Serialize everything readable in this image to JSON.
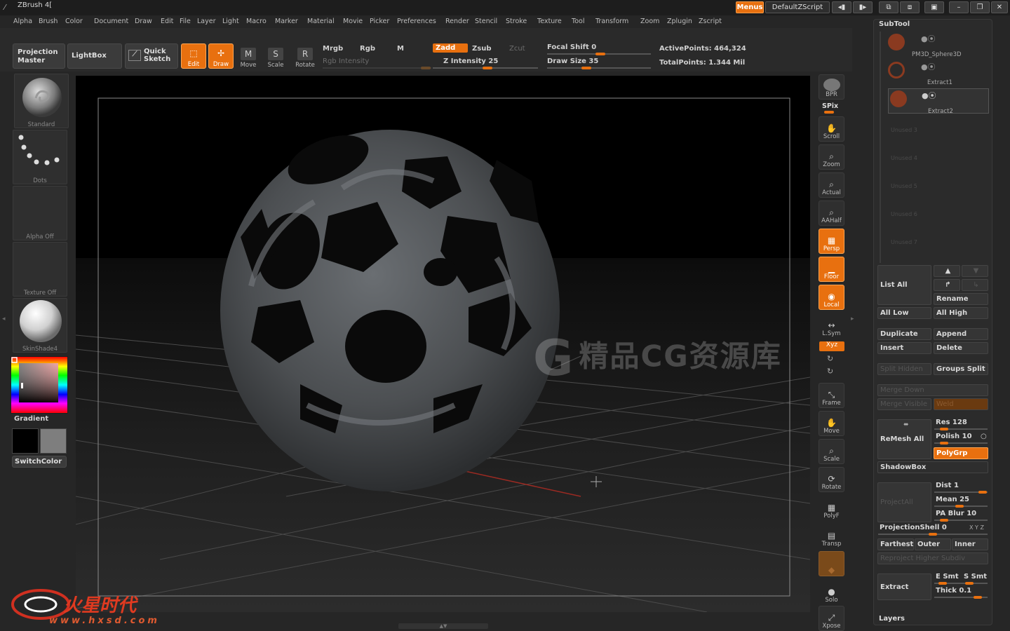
{
  "window": {
    "title": "ZBrush 4["
  },
  "titlebar": {
    "menus_button": "Menus",
    "script_name": "DefaultZScript"
  },
  "menubar": [
    "Alpha",
    "Brush",
    "Color",
    "Document",
    "Draw",
    "Edit",
    "File",
    "Layer",
    "Light",
    "Macro",
    "Marker",
    "Material",
    "Movie",
    "Picker",
    "Preferences",
    "Render",
    "Stencil",
    "Stroke",
    "Texture",
    "Tool",
    "Transform",
    "Zoom",
    "Zplugin",
    "Zscript"
  ],
  "toolbar": {
    "projection_master": "Projection Master",
    "lightbox": "LightBox",
    "quick_sketch": "Quick Sketch",
    "edit": "Edit",
    "draw": "Draw",
    "move": "Move",
    "scale": "Scale",
    "rotate": "Rotate",
    "mrgb": "Mrgb",
    "rgb": "Rgb",
    "m": "M",
    "rgb_intensity": "Rgb Intensity",
    "zadd": "Zadd",
    "zsub": "Zsub",
    "zcut": "Zcut",
    "z_intensity": "Z Intensity 25",
    "focal_shift": "Focal Shift 0",
    "draw_size": "Draw Size 35",
    "active_points": "ActivePoints: 464,324",
    "total_points": "TotalPoints: 1.344 Mil"
  },
  "leftshelf": {
    "brush": "Standard",
    "stroke": "Dots",
    "alpha": "Alpha  Off",
    "texture": "Texture  Off",
    "material": "SkinShade4",
    "gradient": "Gradient",
    "switch_color": "SwitchColor"
  },
  "rightshelf": [
    "BPR",
    "SPix",
    "Scroll",
    "Zoom",
    "Actual",
    "AAHalf",
    "Persp",
    "Floor",
    "Local",
    "L.Sym",
    "Xyz",
    "Frame",
    "Move",
    "Scale",
    "Rotate",
    "PolyF",
    "Transp",
    "Solo",
    "Xpose"
  ],
  "subtool": {
    "header": "SubTool",
    "items": [
      "PM3D_Sphere3D",
      "Extract1",
      "Extract2"
    ],
    "unused": [
      "Unused  3",
      "Unused  4",
      "Unused  5",
      "Unused  6",
      "Unused  7"
    ],
    "list_all": "List  All",
    "rename": "Rename",
    "all_low": "All  Low",
    "all_high": "All  High",
    "duplicate": "Duplicate",
    "append": "Append",
    "insert": "Insert",
    "delete": "Delete",
    "split_hidden": "Split  Hidden",
    "groups_split": "Groups  Split",
    "merge_down": "Merge  Down",
    "merge_visible": "Merge  Visible",
    "weld": "Weld",
    "remesh_all": "ReMesh  All",
    "res": "Res 128",
    "polish": "Polish 10",
    "polygrp": "PolyGrp",
    "shadowbox": "ShadowBox",
    "project_all": "ProjectAll",
    "dist": "Dist 1",
    "mean": "Mean 25",
    "pa_blur": "PA  Blur 10",
    "projection_shell": "ProjectionShell 0",
    "xyz_small": "X Y Z",
    "farthest": "Farthest",
    "outer": "Outer",
    "inner": "Inner",
    "reproject": "Reproject  Higher  Subdiv",
    "extract": "Extract",
    "e_smt": "E  Smt",
    "s_smt": "S  Smt",
    "thick": "Thick 0.1",
    "layers": "Layers"
  },
  "watermark": "精品CG资源库",
  "logo_text": "www.hxsd.com",
  "accent_color": "#e8700f"
}
